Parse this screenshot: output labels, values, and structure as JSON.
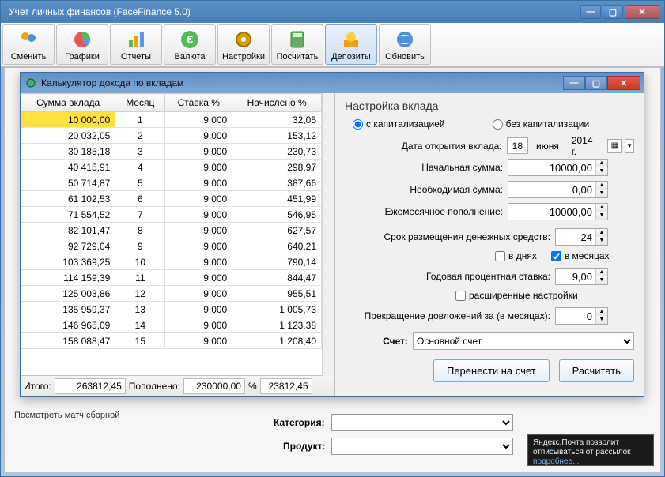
{
  "main_window": {
    "title": "Учет личных финансов (FaceFinance 5.0)"
  },
  "toolbar": [
    {
      "label": "Сменить",
      "icon": "users"
    },
    {
      "label": "Графики",
      "icon": "chart-pie"
    },
    {
      "label": "Отчеты",
      "icon": "chart-bar"
    },
    {
      "label": "Валюта",
      "icon": "euro"
    },
    {
      "label": "Настройки",
      "icon": "gear"
    },
    {
      "label": "Посчитать",
      "icon": "calculator"
    },
    {
      "label": "Депозиты",
      "icon": "deposit",
      "active": true
    },
    {
      "label": "Обновить",
      "icon": "globe-refresh"
    }
  ],
  "bg": {
    "text": "Посмотреть матч сборной",
    "cat_label": "Категория:",
    "prod_label": "Продукт:"
  },
  "notif": {
    "line1": "Яндекс.Почта позволит",
    "line2": "отписываться от рассылок",
    "more": "подробнее..."
  },
  "dialog": {
    "title": "Калькулятор дохода по вкладам",
    "headers": [
      "Сумма вклада",
      "Месяц",
      "Ставка %",
      "Начислено %"
    ],
    "rows": [
      {
        "sum": "10 000,00",
        "m": "1",
        "rate": "9,000",
        "acc": "32,05",
        "hl": true
      },
      {
        "sum": "20 032,05",
        "m": "2",
        "rate": "9,000",
        "acc": "153,12"
      },
      {
        "sum": "30 185,18",
        "m": "3",
        "rate": "9,000",
        "acc": "230,73"
      },
      {
        "sum": "40 415,91",
        "m": "4",
        "rate": "9,000",
        "acc": "298,97"
      },
      {
        "sum": "50 714,87",
        "m": "5",
        "rate": "9,000",
        "acc": "387,66"
      },
      {
        "sum": "61 102,53",
        "m": "6",
        "rate": "9,000",
        "acc": "451,99"
      },
      {
        "sum": "71 554,52",
        "m": "7",
        "rate": "9,000",
        "acc": "546,95"
      },
      {
        "sum": "82 101,47",
        "m": "8",
        "rate": "9,000",
        "acc": "627,57"
      },
      {
        "sum": "92 729,04",
        "m": "9",
        "rate": "9,000",
        "acc": "640,21"
      },
      {
        "sum": "103 369,25",
        "m": "10",
        "rate": "9,000",
        "acc": "790,14"
      },
      {
        "sum": "114 159,39",
        "m": "11",
        "rate": "9,000",
        "acc": "844,47"
      },
      {
        "sum": "125 003,86",
        "m": "12",
        "rate": "9,000",
        "acc": "955,51"
      },
      {
        "sum": "135 959,37",
        "m": "13",
        "rate": "9,000",
        "acc": "1 005,73"
      },
      {
        "sum": "146 965,09",
        "m": "14",
        "rate": "9,000",
        "acc": "1 123,38"
      },
      {
        "sum": "158 088,47",
        "m": "15",
        "rate": "9,000",
        "acc": "1 208,40"
      }
    ],
    "footer": {
      "total_label": "Итого:",
      "total": "263812,45",
      "repl_label": "Пополнено:",
      "repl": "230000,00",
      "pct_label": "%",
      "pct": "23812,45"
    },
    "settings": {
      "title": "Настройка вклада",
      "radio_cap": "с капитализацией",
      "radio_nocap": "без капитализации",
      "open_date_label": "Дата открытия вклада:",
      "date_day": "18",
      "date_month": "июня",
      "date_year": "2014 г.",
      "initial_label": "Начальная сумма:",
      "initial_val": "10000,00",
      "required_label": "Необходимая сумма:",
      "required_val": "0,00",
      "monthly_label": "Ежемесячное пополнение:",
      "monthly_val": "10000,00",
      "term_label": "Срок размещения денежных средств:",
      "term_val": "24",
      "chk_days": "в днях",
      "chk_months": "в месяцах",
      "rate_label": "Годовая процентная ставка:",
      "rate_val": "9,00",
      "chk_ext": "расширенные настройки",
      "stop_label": "Прекращение довложений за (в месяцах):",
      "stop_val": "0",
      "account_label": "Счет:",
      "account_val": "Основной счет",
      "btn_transfer": "Перенести на счет",
      "btn_calc": "Расчитать"
    }
  }
}
